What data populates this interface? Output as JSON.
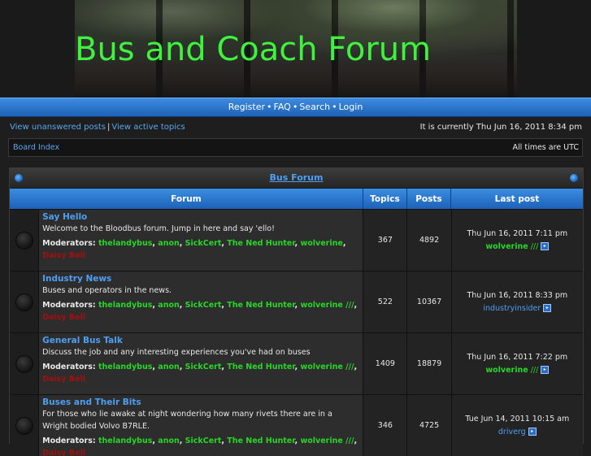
{
  "header": {
    "site_title": "Bus and Coach Forum"
  },
  "nav": {
    "register": "Register",
    "faq": "FAQ",
    "search": "Search",
    "login": "Login"
  },
  "info": {
    "unanswered": "View unanswered posts",
    "active": "View active topics",
    "time": "It is currently Thu Jun 16, 2011 8:34 pm"
  },
  "board": {
    "index": "Board Index",
    "timezone": "All times are UTC"
  },
  "category": {
    "title": "Bus Forum"
  },
  "columns": {
    "forum": "Forum",
    "topics": "Topics",
    "posts": "Posts",
    "last": "Last post"
  },
  "moderators_label": "Moderators:",
  "mods": [
    "thelandybus",
    "anon",
    "SickCert",
    "The Ned Hunter",
    "wolverine",
    "Daisy Bell"
  ],
  "forums": [
    {
      "title": "Say Hello",
      "desc": "Welcome to the Bloodbus forum. Jump in here and say 'ello!",
      "topics": "367",
      "posts": "4892",
      "last_time": "Thu Jun 16, 2011 7:11 pm",
      "last_user": "wolverine",
      "last_suffix": "///"
    },
    {
      "title": "Industry News",
      "desc": "Buses and operators in the news.",
      "topics": "522",
      "posts": "10367",
      "last_time": "Thu Jun 16, 2011 8:33 pm",
      "last_user": "industryinsider",
      "last_suffix": ""
    },
    {
      "title": "General Bus Talk",
      "desc": "Discuss the job and any interesting experiences you've had on buses",
      "topics": "1409",
      "posts": "18879",
      "last_time": "Thu Jun 16, 2011 7:22 pm",
      "last_user": "wolverine",
      "last_suffix": "///"
    },
    {
      "title": "Buses and Their Bits",
      "desc": "For those who lie awake at night wondering how many rivets there are in a Wright bodied Volvo B7RLE.",
      "topics": "346",
      "posts": "4725",
      "last_time": "Tue Jun 14, 2011 10:15 am",
      "last_user": "driverg",
      "last_suffix": ""
    }
  ]
}
